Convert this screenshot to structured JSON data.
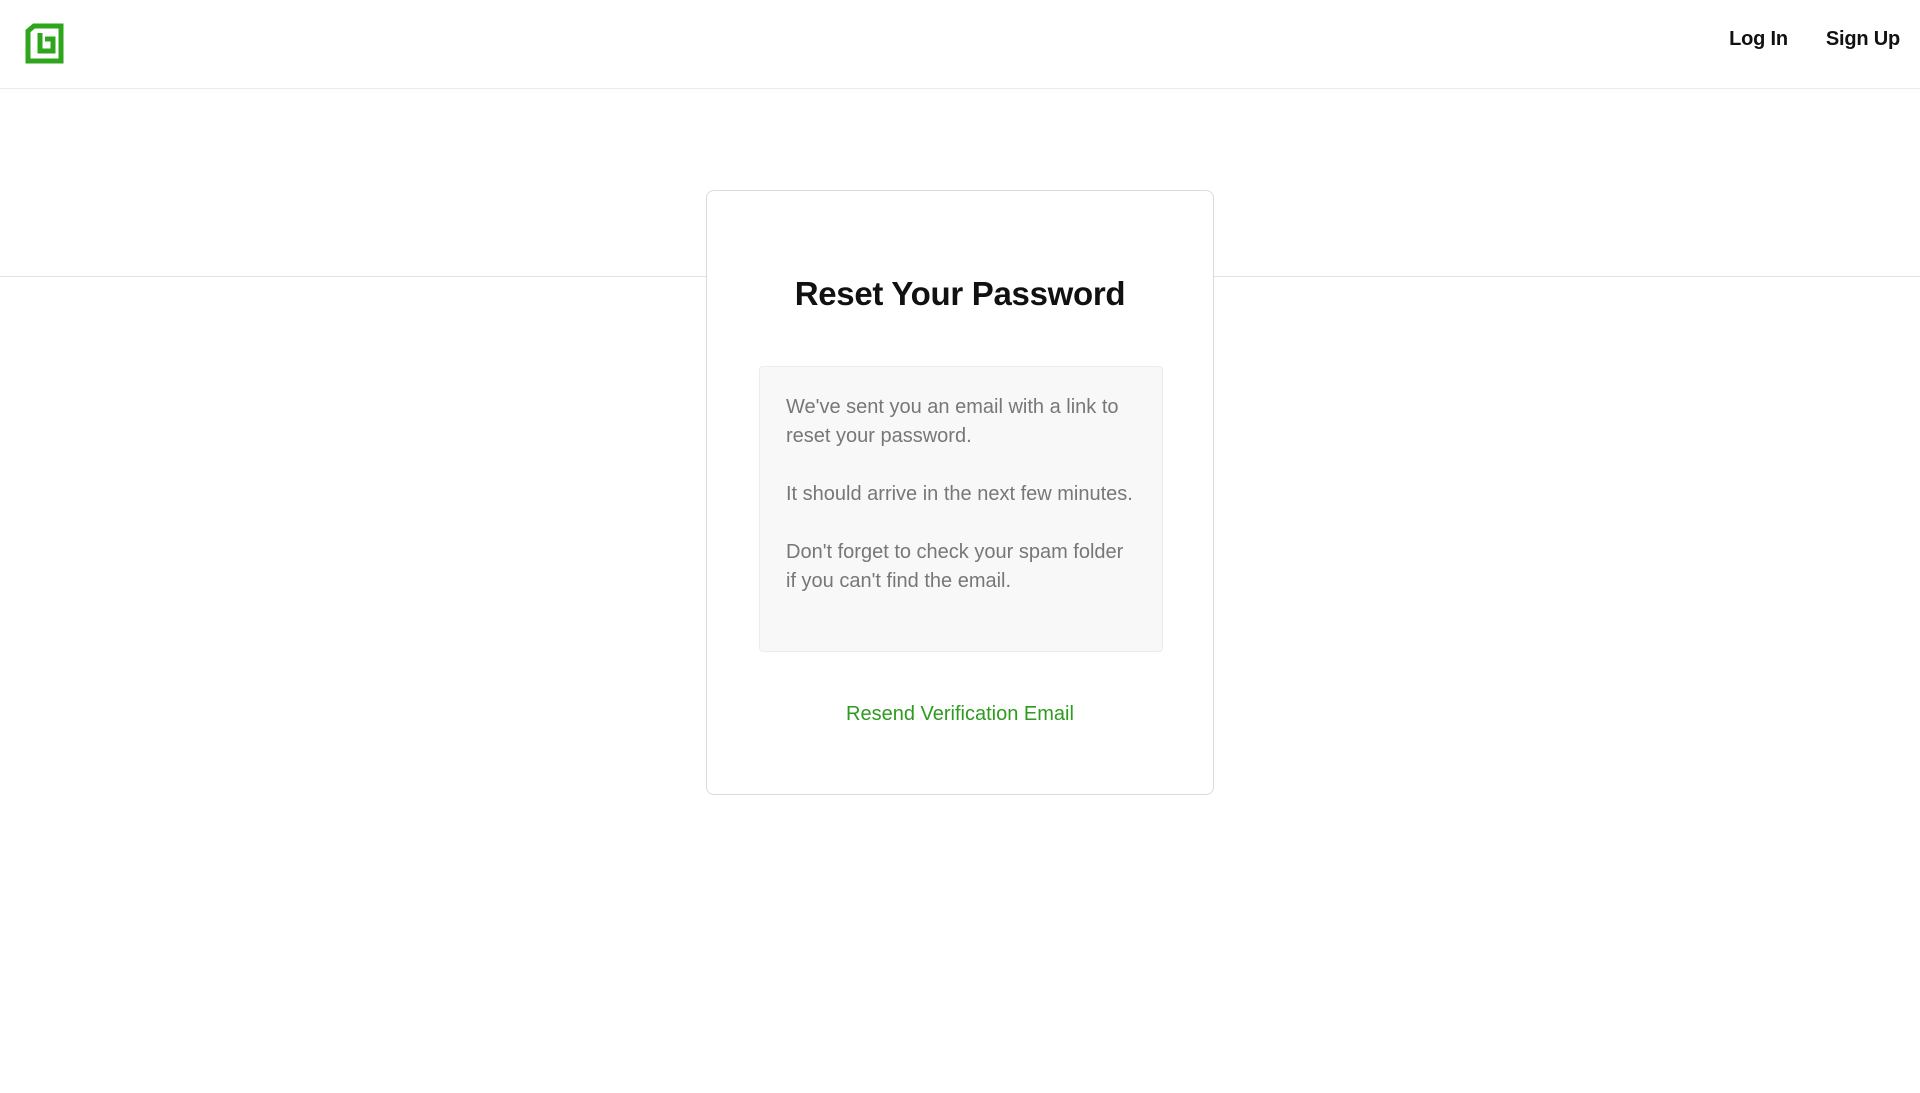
{
  "header": {
    "logo_icon": "brand-spiral-logo-icon",
    "brand_color": "#2fa51d",
    "nav": {
      "login_label": "Log In",
      "signup_label": "Sign Up"
    }
  },
  "card": {
    "title": "Reset Your Password",
    "messages": [
      "We've sent you an email with a link to reset your password.",
      "It should arrive in the next few minutes.",
      "Don't forget to check your spam folder if you can't find the email."
    ],
    "resend_label": "Resend Verification Email",
    "link_color": "#2e9a1f"
  }
}
